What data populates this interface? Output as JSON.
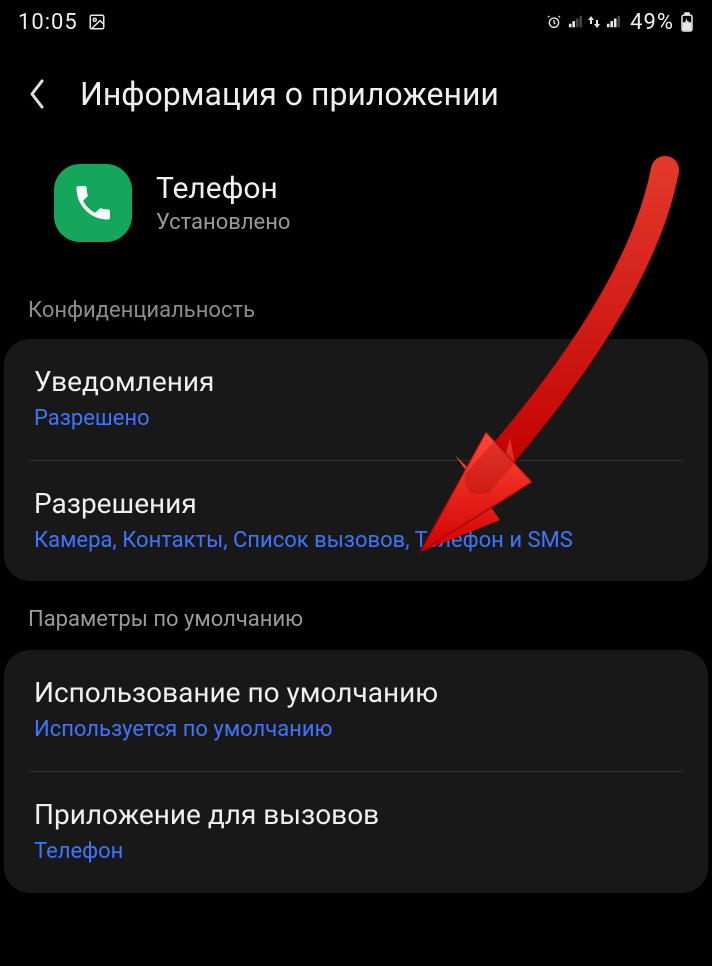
{
  "status": {
    "time": "10:05",
    "battery": "49%"
  },
  "header": {
    "title": "Информация о приложении"
  },
  "app": {
    "name": "Телефон",
    "status": "Установлено"
  },
  "sections": {
    "privacy_header": "Конфиденциальность",
    "defaults_header": "Параметры по умолчанию"
  },
  "items": {
    "notifications": {
      "title": "Уведомления",
      "value": "Разрешено"
    },
    "permissions": {
      "title": "Разрешения",
      "value": "Камера, Контакты, Список вызовов, Телефон и SMS"
    },
    "default_use": {
      "title": "Использование по умолчанию",
      "value": "Используется по умолчанию"
    },
    "call_app": {
      "title": "Приложение для вызовов",
      "value": "Телефон"
    }
  }
}
